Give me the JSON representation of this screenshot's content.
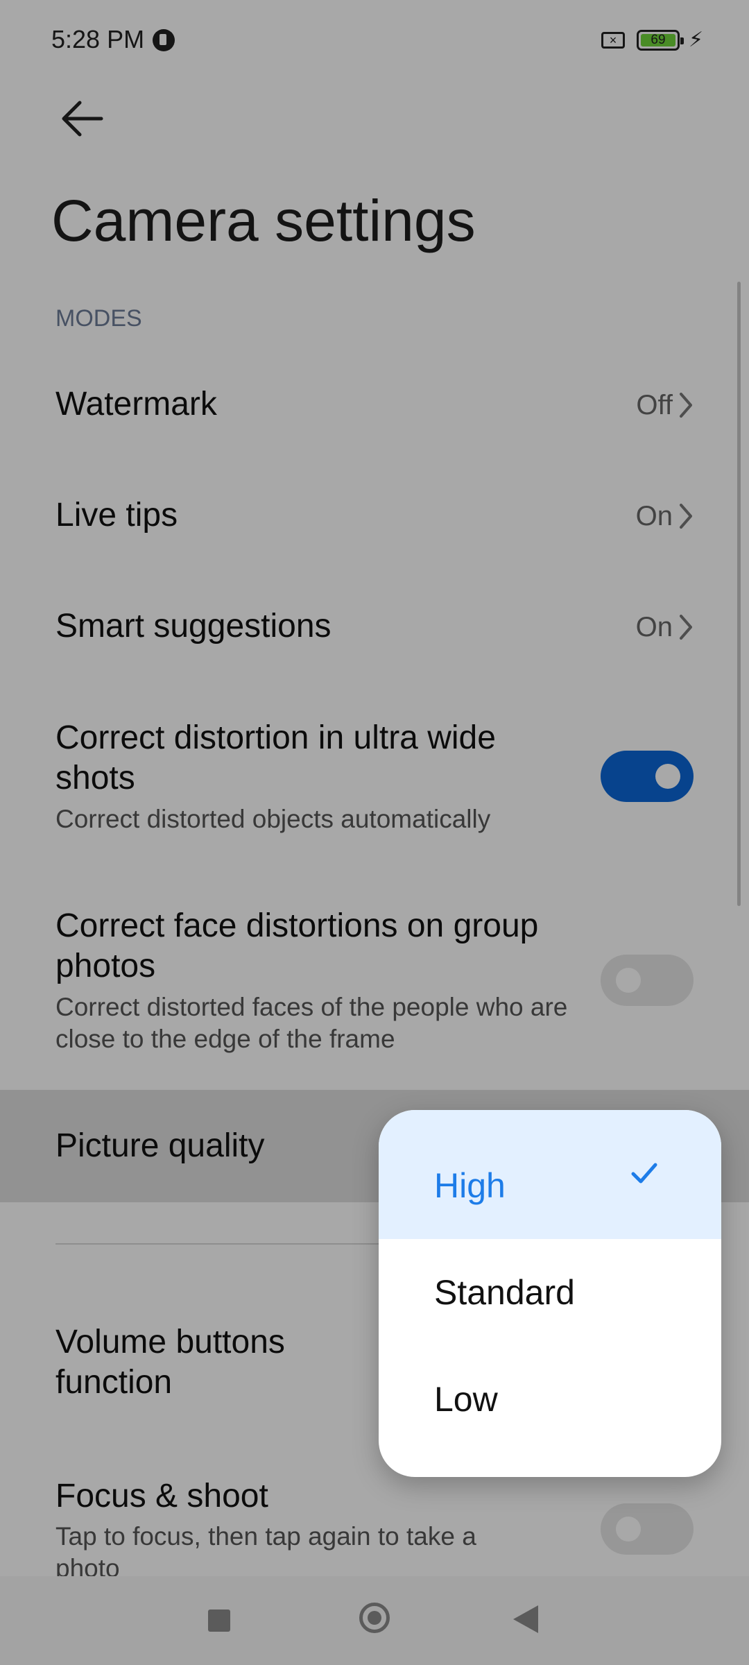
{
  "status_bar": {
    "time": "5:28 PM",
    "battery_level": "69"
  },
  "page": {
    "title": "Camera settings",
    "section": "MODES"
  },
  "settings": {
    "watermark": {
      "title": "Watermark",
      "value": "Off"
    },
    "live_tips": {
      "title": "Live tips",
      "value": "On"
    },
    "smart_suggestions": {
      "title": "Smart suggestions",
      "value": "On"
    },
    "correct_distortion": {
      "title": "Correct distortion in ultra wide shots",
      "subtitle": "Correct distorted objects automatically",
      "enabled": true
    },
    "face_distortion": {
      "title": "Correct face distortions on group photos",
      "subtitle": "Correct distorted faces of the people who are close to the edge of the frame",
      "enabled": false
    },
    "picture_quality": {
      "title": "Picture quality"
    },
    "volume_buttons": {
      "title": "Volume buttons function"
    },
    "focus_shoot": {
      "title": "Focus & shoot",
      "subtitle": "Tap to focus, then tap again to take a photo",
      "enabled": false
    }
  },
  "quality_menu": {
    "options": [
      "High",
      "Standard",
      "Low"
    ],
    "selected": "High"
  },
  "colors": {
    "accent": "#0b67d7",
    "menu_selected_text": "#1d7ce8",
    "menu_selected_background": "#e3f0ff"
  },
  "icons": {
    "back": "back-arrow-icon",
    "chevron": "chevron-right-icon",
    "check": "check-icon"
  }
}
